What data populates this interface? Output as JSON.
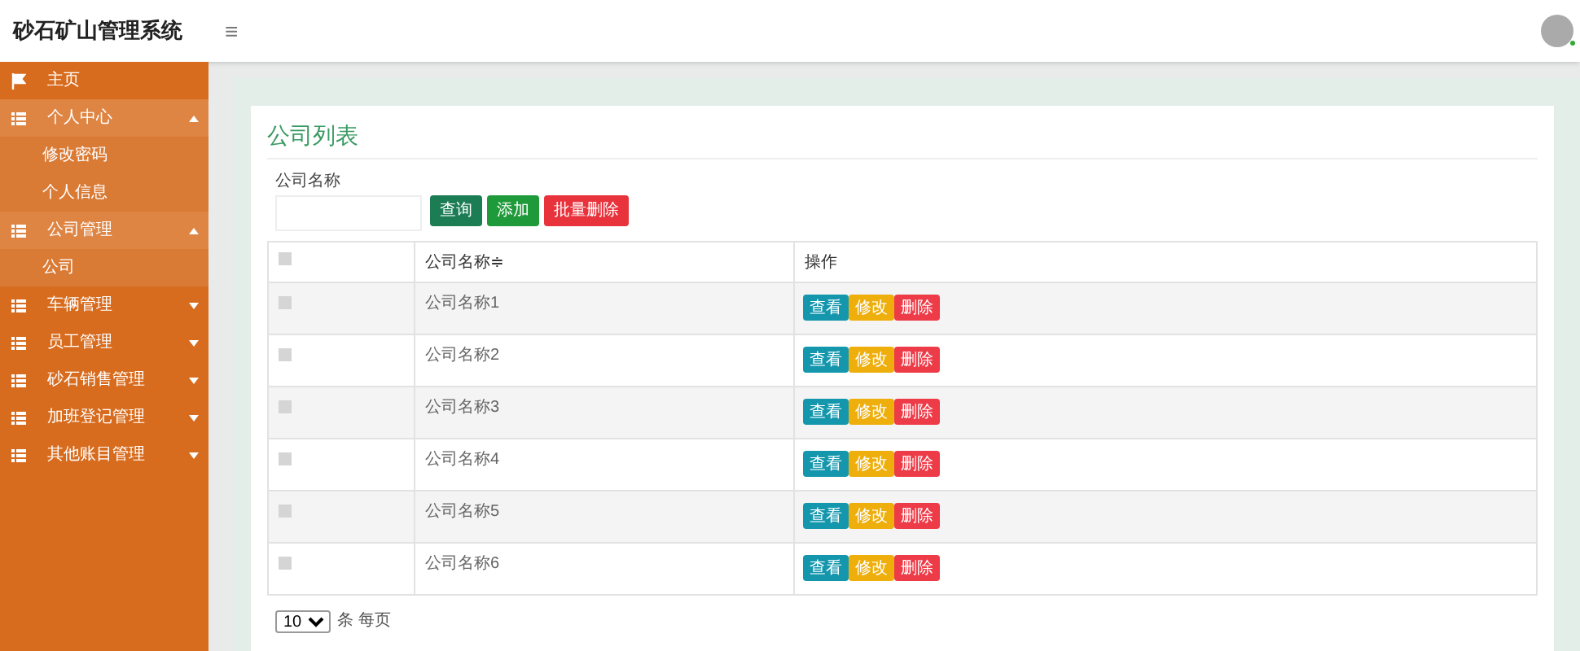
{
  "app_title": "砂石矿山管理系统",
  "menu_toggle": "≡",
  "sidebar": {
    "items": [
      {
        "label": "主页",
        "kind": "link",
        "expanded": false
      },
      {
        "label": "个人中心",
        "kind": "menu",
        "expanded": true,
        "children": [
          {
            "label": "修改密码"
          },
          {
            "label": "个人信息"
          }
        ]
      },
      {
        "label": "公司管理",
        "kind": "menu",
        "expanded": true,
        "children": [
          {
            "label": "公司"
          }
        ]
      },
      {
        "label": "车辆管理",
        "kind": "menu",
        "expanded": false
      },
      {
        "label": "员工管理",
        "kind": "menu",
        "expanded": false
      },
      {
        "label": "砂石销售管理",
        "kind": "menu",
        "expanded": false
      },
      {
        "label": "加班登记管理",
        "kind": "menu",
        "expanded": false
      },
      {
        "label": "其他账目管理",
        "kind": "menu",
        "expanded": false
      }
    ]
  },
  "card": {
    "title": "公司列表",
    "search": {
      "label": "公司名称",
      "buttons": [
        {
          "label": "查询",
          "kind": "search"
        },
        {
          "label": "添加",
          "kind": "add"
        },
        {
          "label": "批量删除",
          "kind": "delete"
        }
      ]
    },
    "table": {
      "columns": [
        "公司名称≑",
        "操作"
      ],
      "all_checked": false,
      "rows": [
        {
          "name": "公司名称1",
          "checked": false,
          "actions": [
            "查看",
            "修改",
            "删除"
          ]
        },
        {
          "name": "公司名称2",
          "checked": false,
          "actions": [
            "查看",
            "修改",
            "删除"
          ]
        },
        {
          "name": "公司名称3",
          "checked": false,
          "actions": [
            "查看",
            "修改",
            "删除"
          ]
        },
        {
          "name": "公司名称4",
          "checked": false,
          "actions": [
            "查看",
            "修改",
            "删除"
          ]
        },
        {
          "name": "公司名称5",
          "checked": false,
          "actions": [
            "查看",
            "修改",
            "删除"
          ]
        },
        {
          "name": "公司名称6",
          "checked": false,
          "actions": [
            "查看",
            "修改",
            "删除"
          ]
        }
      ]
    },
    "page_size": "10",
    "page_size_suffix": "条 每页"
  }
}
